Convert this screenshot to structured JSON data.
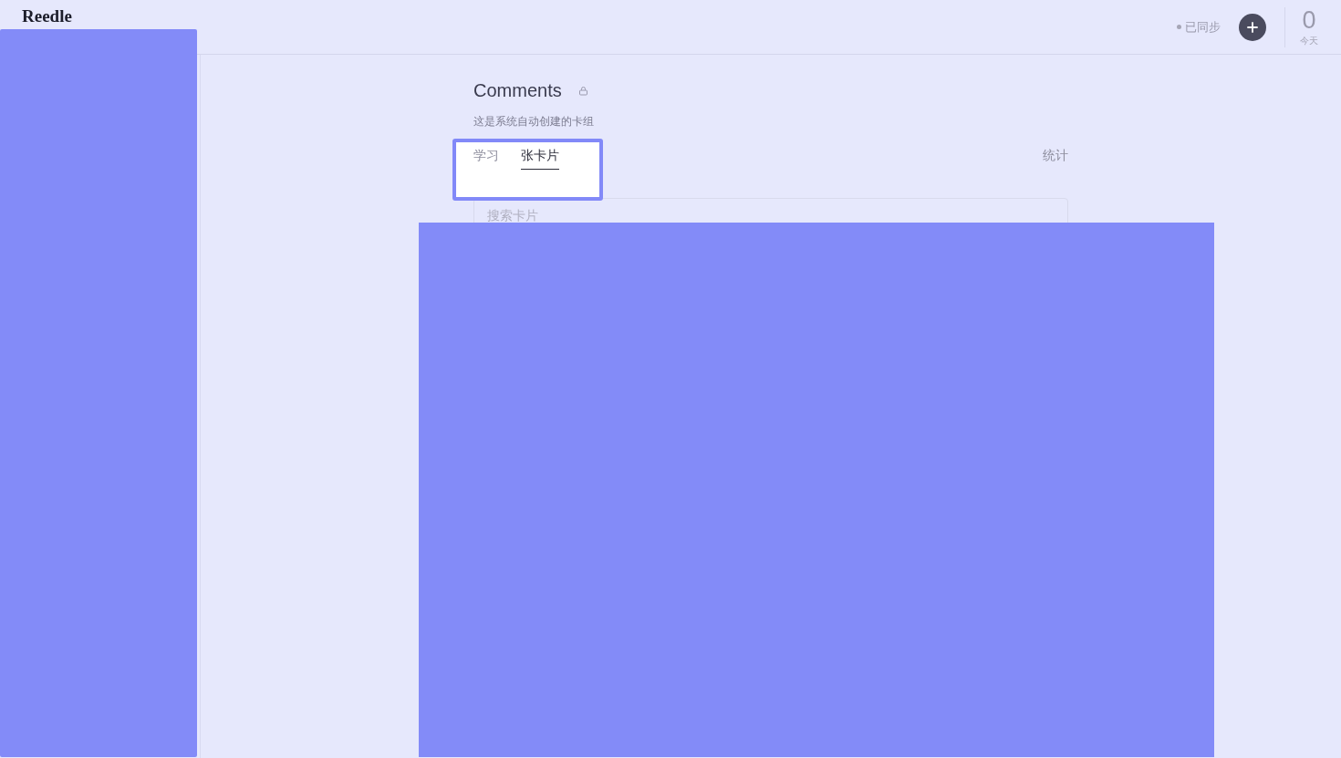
{
  "header": {
    "logo": "Reedle",
    "sync_status": "已同步",
    "today_count": "0",
    "today_label": "今天"
  },
  "deck": {
    "title": "Comments",
    "description": "这是系统自动创建的卡组"
  },
  "tabs": [
    {
      "label": "学习",
      "selected": false
    },
    {
      "label": "张卡片",
      "selected": true
    }
  ],
  "stats_link": "统计",
  "search": {
    "placeholder": "搜索卡片"
  }
}
